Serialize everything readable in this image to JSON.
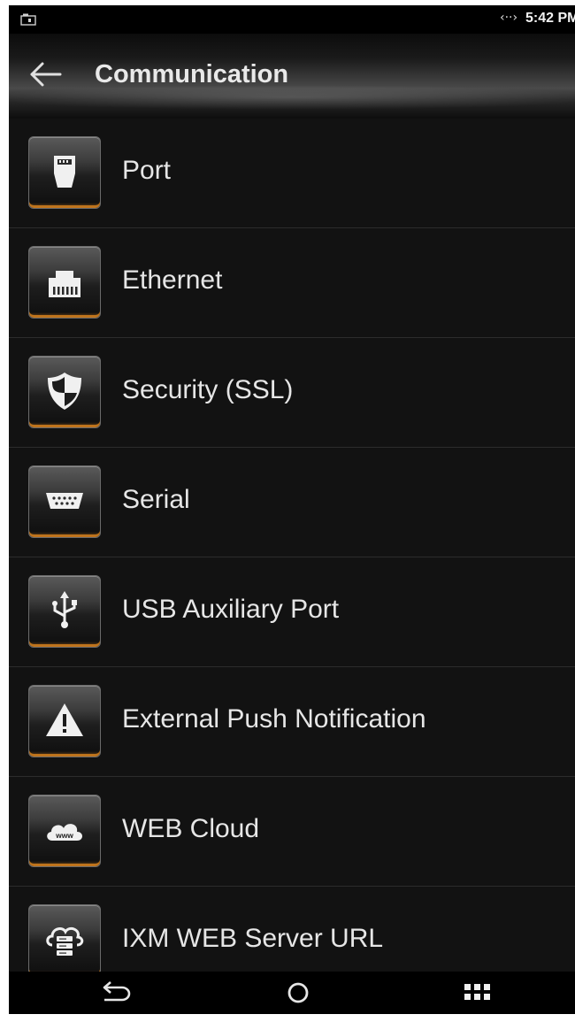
{
  "status_bar": {
    "left_icon": "screen-icon",
    "sync_icon": "‹··›",
    "time": "5:42 PM"
  },
  "header": {
    "back_icon": "back-arrow-icon",
    "title": "Communication"
  },
  "items": [
    {
      "label": "Port",
      "icon": "port-plug-icon"
    },
    {
      "label": "Ethernet",
      "icon": "ethernet-icon"
    },
    {
      "label": "Security (SSL)",
      "icon": "shield-icon"
    },
    {
      "label": "Serial",
      "icon": "serial-port-icon"
    },
    {
      "label": "USB Auxiliary Port",
      "icon": "usb-icon"
    },
    {
      "label": "External Push Notification",
      "icon": "warning-icon"
    },
    {
      "label": "WEB Cloud",
      "icon": "cloud-www-icon",
      "icon_text": "www"
    },
    {
      "label": "IXM WEB Server URL",
      "icon": "cloud-server-icon"
    }
  ],
  "nav_bar": {
    "back": "nav-back-icon",
    "home": "nav-home-icon",
    "apps": "nav-apps-icon"
  },
  "colors": {
    "background": "#121212",
    "text": "#e6e6e6",
    "accent_orange": "#b8701a",
    "divider": "#2c2c2c"
  }
}
